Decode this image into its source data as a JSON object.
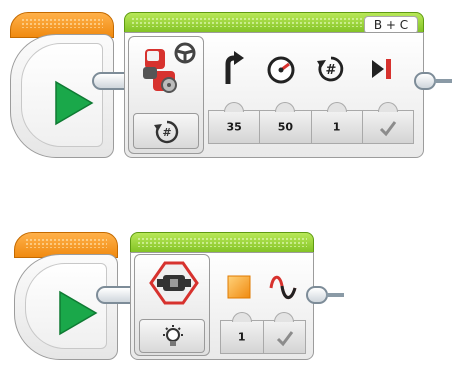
{
  "program_1": {
    "start_block": {
      "icon": "play-icon"
    },
    "move_steering_block": {
      "port_label": "B + C",
      "mode_icon": "rotations-icon",
      "param_icons": [
        "steering-icon",
        "power-icon",
        "rotations-count-icon",
        "brake-at-end-icon"
      ],
      "params": {
        "steering": "35",
        "power": "50",
        "rotations": "1",
        "brake_at_end": "checkmark"
      }
    }
  },
  "program_2": {
    "start_block": {
      "icon": "play-icon"
    },
    "brick_status_light_block": {
      "mode_icon": "light-bulb-icon",
      "param_icons": [
        "light-color-icon",
        "pulse-icon"
      ],
      "params": {
        "color": "1",
        "pulse": "checkmark"
      }
    }
  },
  "colors": {
    "start_orange": "#f08a10",
    "action_green": "#7bbd1e",
    "play_green": "#1aa84a",
    "motor_red": "#d7322e"
  }
}
